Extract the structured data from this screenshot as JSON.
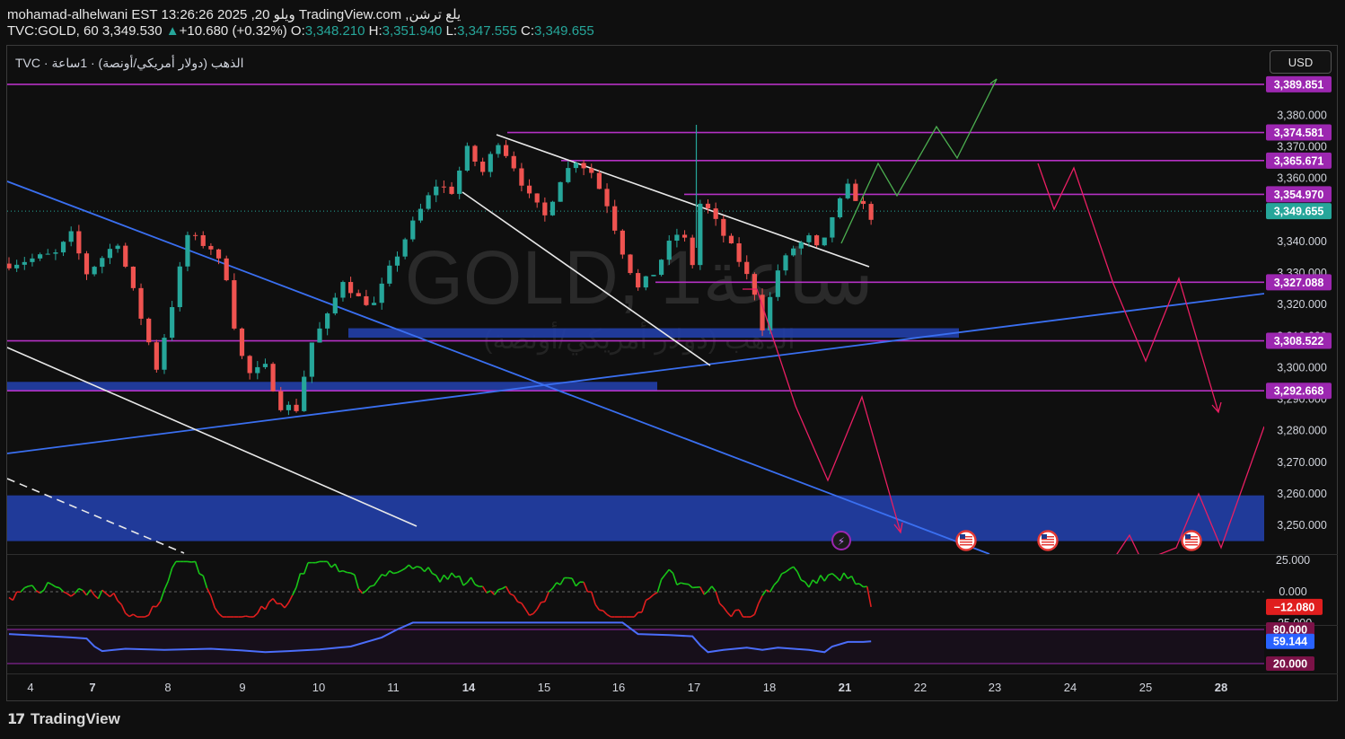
{
  "header": {
    "line1": "mohamad-alhelwani EST 13:26:26 2025 ,20 ويلو TradingView.com ,يلع ترشن",
    "symbol": "TVC:GOLD, 60",
    "last": "3,349.530",
    "change_arrow": "▲",
    "change": "+10.680 (+0.32%)",
    "o_label": "O:",
    "o_value": "3,348.210",
    "h_label": "H:",
    "h_value": "3,351.940",
    "l_label": "L:",
    "l_value": "3,347.555",
    "c_label": "C:",
    "c_value": "3,349.655"
  },
  "legend": {
    "text": "TVC · الذهب (دولار أمريكي/أونصة) · 1ساعة"
  },
  "watermark": {
    "line1": "GOLD, 1ساعة",
    "line2": "الذهب (دولار أمريكي/أونصة)"
  },
  "currency_button": "USD",
  "brand": {
    "mark_text": "𝟭𝟳",
    "text": "TradingView"
  },
  "colors": {
    "background": "#0f0f0f",
    "up": "#26a69a",
    "down": "#ef5350",
    "level_line": "#b531c4",
    "trend_blue": "#3a6ff0",
    "zone_blue": "#223fa8",
    "projection_up": "#4caf50",
    "projection_down": "#e91e63",
    "osc_up": "#18c418",
    "osc_down": "#e01e1e",
    "rsi_line": "#4b6dfa"
  },
  "chart_data": {
    "type": "candlestick",
    "symbol": "TVC:GOLD",
    "interval": "60",
    "currency": "USD",
    "x_ticks": [
      "4",
      "7",
      "8",
      "9",
      "10",
      "11",
      "14",
      "15",
      "16",
      "17",
      "18",
      "21",
      "22",
      "23",
      "24",
      "25",
      "28"
    ],
    "bold_x_ticks": [
      "7",
      "14",
      "21",
      "28"
    ],
    "price_ticks": [
      "3,380.000",
      "3,370.000",
      "3,360.000",
      "3,350.000",
      "3,340.000",
      "3,330.000",
      "3,320.000",
      "3,310.000",
      "3,300.000",
      "3,290.000",
      "3,280.000",
      "3,270.000",
      "3,260.000",
      "3,250.000"
    ],
    "price_range": [
      3244,
      3392
    ],
    "horizontal_levels": [
      {
        "value": 3389.851,
        "label": "3,389.851"
      },
      {
        "value": 3374.581,
        "label": "3,374.581"
      },
      {
        "value": 3365.671,
        "label": "3,365.671"
      },
      {
        "value": 3354.97,
        "label": "3,354.970"
      },
      {
        "value": 3327.088,
        "label": "3,327.088"
      },
      {
        "value": 3308.522,
        "label": "3,308.522"
      },
      {
        "value": 3292.668,
        "label": "3,292.668"
      }
    ],
    "current_price": {
      "value": 3349.655,
      "label": "3,349.655"
    },
    "zones": [
      {
        "from": 3309.5,
        "to": 3312.5
      },
      {
        "from": 3292.5,
        "to": 3295.5
      },
      {
        "from": 3245,
        "to": 3259.5
      }
    ],
    "price_path": [
      [
        0,
        3333
      ],
      [
        6,
        3336
      ],
      [
        8,
        3342
      ],
      [
        10,
        3330
      ],
      [
        14,
        3340
      ],
      [
        17,
        3316
      ],
      [
        19,
        3300
      ],
      [
        21,
        3320
      ],
      [
        23,
        3342
      ],
      [
        26,
        3338
      ],
      [
        28,
        3329
      ],
      [
        29.5,
        3306
      ],
      [
        31,
        3298
      ],
      [
        33,
        3300
      ],
      [
        35,
        3288
      ],
      [
        37,
        3287
      ],
      [
        39,
        3308
      ],
      [
        41,
        3316
      ],
      [
        43,
        3328
      ],
      [
        45,
        3322
      ],
      [
        47,
        3320
      ],
      [
        49,
        3331
      ],
      [
        51,
        3341
      ],
      [
        53,
        3350
      ],
      [
        55,
        3358
      ],
      [
        57,
        3356
      ],
      [
        59,
        3369
      ],
      [
        61,
        3362
      ],
      [
        63,
        3372
      ],
      [
        65,
        3364
      ],
      [
        67,
        3354
      ],
      [
        69,
        3348
      ],
      [
        71,
        3360
      ],
      [
        73,
        3366
      ],
      [
        75,
        3362
      ],
      [
        77,
        3352
      ],
      [
        79,
        3337
      ],
      [
        81,
        3325
      ],
      [
        83,
        3330
      ],
      [
        85,
        3339
      ],
      [
        86.5,
        3344
      ],
      [
        88,
        3333
      ],
      [
        88.5,
        3353
      ],
      [
        90,
        3350
      ],
      [
        92,
        3342
      ],
      [
        94,
        3334
      ],
      [
        96,
        3324
      ],
      [
        97,
        3313
      ],
      [
        99,
        3331
      ],
      [
        101,
        3338
      ],
      [
        103,
        3341
      ],
      [
        104.5,
        3336
      ],
      [
        106,
        3348
      ],
      [
        108,
        3357
      ],
      [
        110,
        3351
      ],
      [
        111,
        3348
      ]
    ],
    "momentum_oscillator": {
      "ticks": [
        "25.000",
        "0.000"
      ],
      "hidden_tick": "-25.000",
      "range": [
        -25,
        25
      ],
      "current": {
        "value": -12.08,
        "label": "−12.080"
      }
    },
    "rsi": {
      "levels": [
        {
          "value": 80,
          "label": "80.000"
        },
        {
          "value": 20,
          "label": "20.000"
        }
      ],
      "hidden_tick": "0.000",
      "range": [
        10,
        100
      ],
      "current": {
        "value": 59.144,
        "label": "59.144"
      }
    }
  }
}
